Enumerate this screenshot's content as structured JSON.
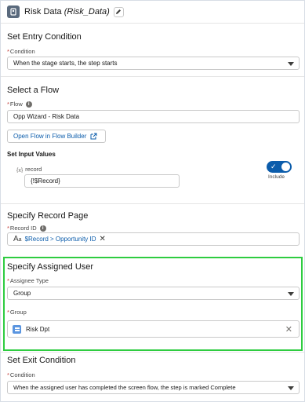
{
  "header": {
    "title": "Risk Data",
    "api_name": "(Risk_Data)"
  },
  "entry": {
    "section_title": "Set Entry Condition",
    "condition_label": "Condition",
    "condition_value": "When the stage starts, the step starts"
  },
  "flow": {
    "section_title": "Select a Flow",
    "flow_label": "Flow",
    "flow_value": "Opp Wizard - Risk Data",
    "open_button": "Open Flow in Flow Builder",
    "inputs_title": "Set Input Values",
    "param_name": "record",
    "param_value": "{!$Record}",
    "include_label": "Include"
  },
  "record_page": {
    "section_title": "Specify Record Page",
    "record_id_label": "Record ID",
    "record_id_value": "$Record > Opportunity ID"
  },
  "assigned_user": {
    "section_title": "Specify Assigned User",
    "assignee_type_label": "Assignee Type",
    "assignee_type_value": "Group",
    "group_label": "Group",
    "group_value": "Risk Dpt"
  },
  "exit": {
    "section_title": "Set Exit Condition",
    "condition_label": "Condition",
    "condition_value": "When the assigned user has completed the screen flow, the step is marked Complete"
  },
  "colors": {
    "accent": "#0b5cab",
    "highlight": "#2ecc40",
    "required": "#c23934"
  },
  "icons": [
    "stage-step-icon",
    "edit-icon",
    "info-icon",
    "external-link-icon",
    "variable-icon",
    "text-resource-icon",
    "toggle-check-icon",
    "close-icon",
    "group-icon",
    "chevron-down-icon"
  ]
}
